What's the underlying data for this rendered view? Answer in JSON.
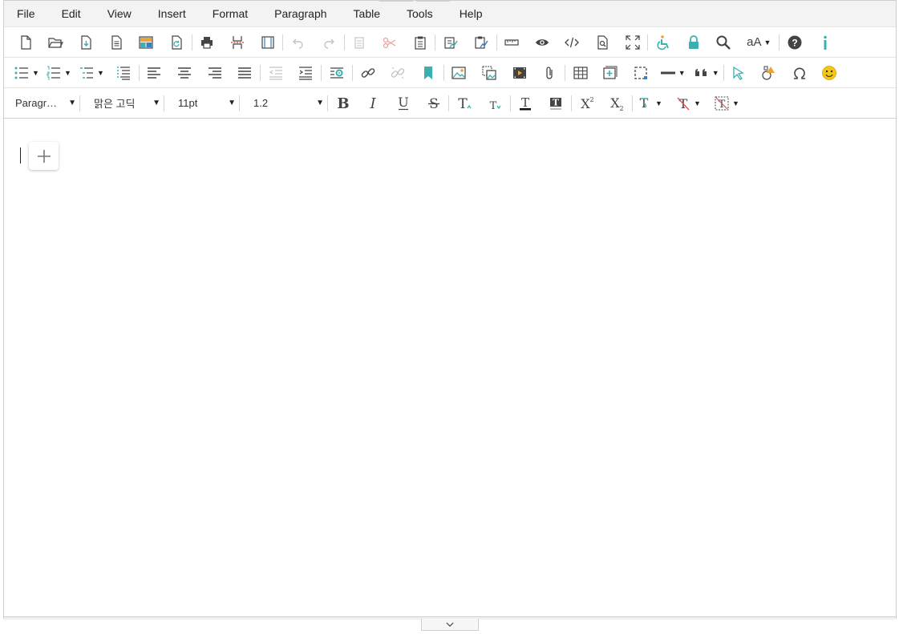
{
  "menubar": {
    "items": [
      "File",
      "Edit",
      "View",
      "Insert",
      "Format",
      "Paragraph",
      "Table",
      "Tools",
      "Help"
    ]
  },
  "toolbar1": {
    "icons": [
      "new-document-icon",
      "open-folder-icon",
      "save-icon",
      "template-icon",
      "layout-icon",
      "restore-icon",
      "print-icon",
      "page-break-icon",
      "page-setup-icon",
      "undo-icon",
      "redo-icon",
      "copy-icon",
      "cut-icon",
      "paste-icon",
      "paste-text-icon",
      "paste-word-icon",
      "ruler-icon",
      "preview-icon",
      "source-code-icon",
      "find-page-icon",
      "fullscreen-icon",
      "accessibility-icon",
      "lock-icon",
      "search-icon",
      "font-size-icon",
      "help-icon",
      "info-icon"
    ],
    "font_size_label": "aA"
  },
  "toolbar2": {
    "icons": [
      "bullet-list-icon",
      "numbered-list-icon",
      "multilevel-list-icon",
      "outline-icon",
      "align-left-icon",
      "align-center-icon",
      "align-right-icon",
      "align-justify-icon",
      "outdent-icon",
      "indent-icon",
      "paragraph-settings-icon",
      "link-icon",
      "unlink-icon",
      "bookmark-icon",
      "image-icon",
      "image-edit-icon",
      "video-icon",
      "attachment-icon",
      "table-icon",
      "insert-box-icon",
      "select-region-icon",
      "horizontal-line-icon",
      "blockquote-icon",
      "select-pointer-icon",
      "shapes-icon",
      "omega-icon",
      "emoji-icon"
    ]
  },
  "toolbar3": {
    "paragraph_style": "Paragr…",
    "font_family": "맑은 고딕",
    "font_size": "11pt",
    "line_height": "1.2",
    "icons": [
      "bold-icon",
      "italic-icon",
      "underline-icon",
      "strikethrough-icon",
      "font-increase-icon",
      "font-decrease-icon",
      "text-color-icon",
      "highlight-icon",
      "superscript-icon",
      "subscript-icon",
      "format-painter-icon",
      "clear-format-icon",
      "clear-all-format-icon"
    ]
  },
  "colors": {
    "accent": "#3ab0b0",
    "icon_gray": "#444444",
    "disabled": "#c4c4c4",
    "menubar_bg": "#f3f3f3"
  }
}
